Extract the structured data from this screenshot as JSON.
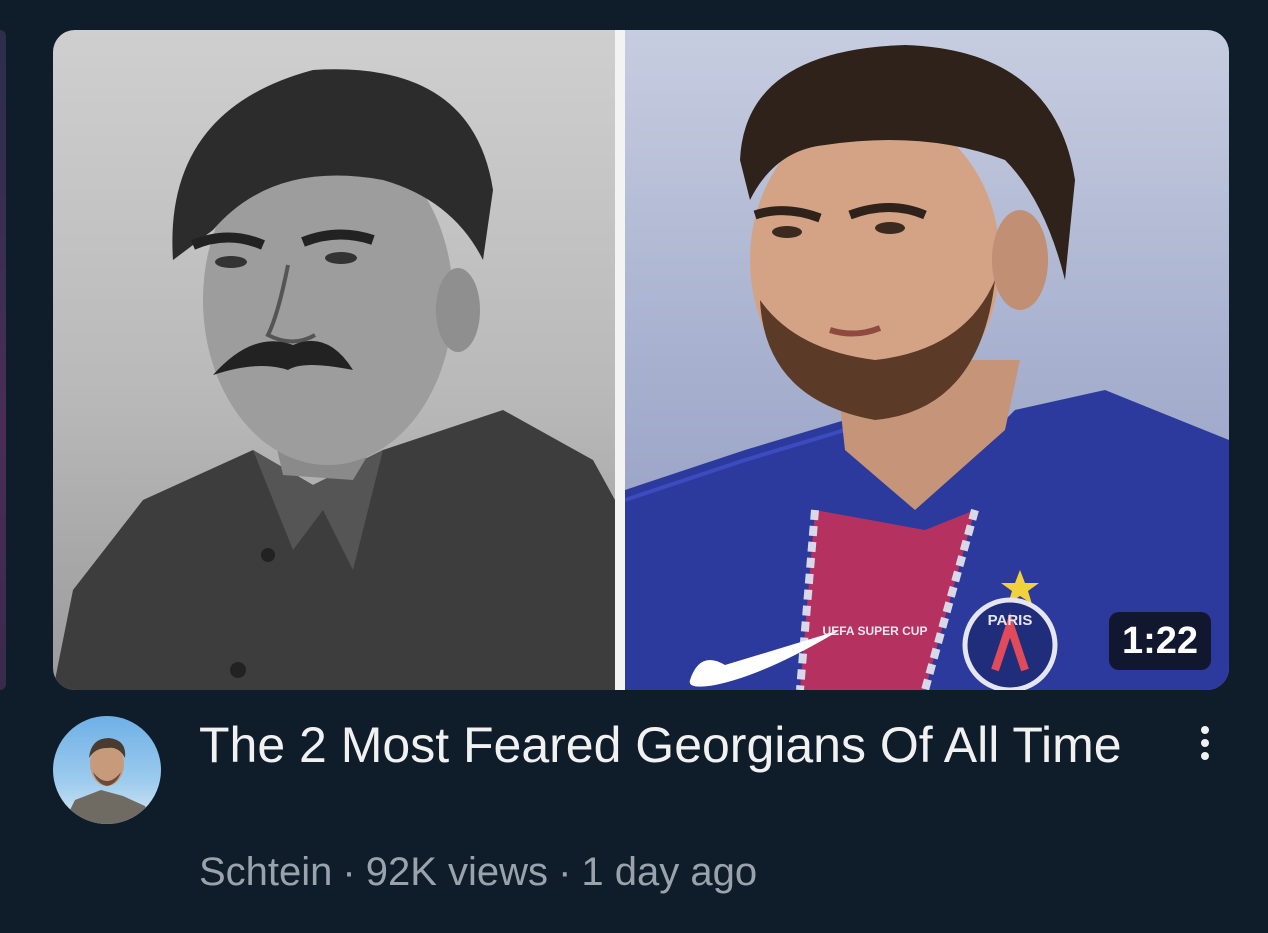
{
  "video": {
    "duration": "1:22",
    "title": "The 2 Most Feared Georgians Of All Time",
    "channel": "Schtein",
    "separator": "·",
    "views": "92K views",
    "age": "1 day ago"
  },
  "thumbnail": {
    "left_image": "black-and-white portrait of a man with a mustache in a military tunic",
    "right_image": "bearded footballer in a blue PSG jersey",
    "jersey_text": "PARIS",
    "jersey_patch": "UEFA SUPER CUP"
  },
  "icons": {
    "more": "more-vertical-icon"
  }
}
